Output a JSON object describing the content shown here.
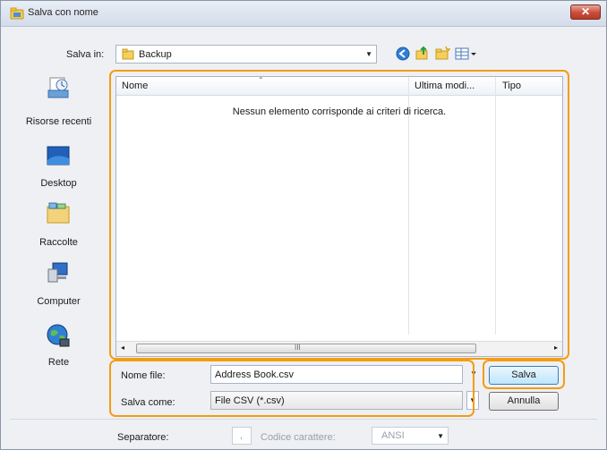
{
  "window": {
    "title": "Salva con nome",
    "close_label": "✕"
  },
  "save_in": {
    "label": "Salva in:",
    "value": "Backup"
  },
  "sidebar": {
    "items": [
      {
        "label": "Risorse recenti",
        "icon": "recent-places-icon"
      },
      {
        "label": "Desktop",
        "icon": "desktop-icon"
      },
      {
        "label": "Raccolte",
        "icon": "libraries-icon"
      },
      {
        "label": "Computer",
        "icon": "computer-icon"
      },
      {
        "label": "Rete",
        "icon": "network-icon"
      }
    ]
  },
  "file_list": {
    "columns": [
      "Nome",
      "Ultima modi...",
      "Tipo"
    ],
    "empty_message": "Nessun elemento corrisponde ai criteri di ricerca.",
    "scroll_mark": "III"
  },
  "form": {
    "filename_label": "Nome file:",
    "filename_value": "Address Book.csv",
    "savetype_label": "Salva come:",
    "savetype_value": "File CSV (*.csv)"
  },
  "buttons": {
    "save": "Salva",
    "cancel": "Annulla"
  },
  "options": {
    "separator_label": "Separatore:",
    "separator_value": ",",
    "charset_label": "Codice carattere:",
    "charset_value": "ANSI"
  },
  "colors": {
    "highlight": "#f39c12"
  }
}
